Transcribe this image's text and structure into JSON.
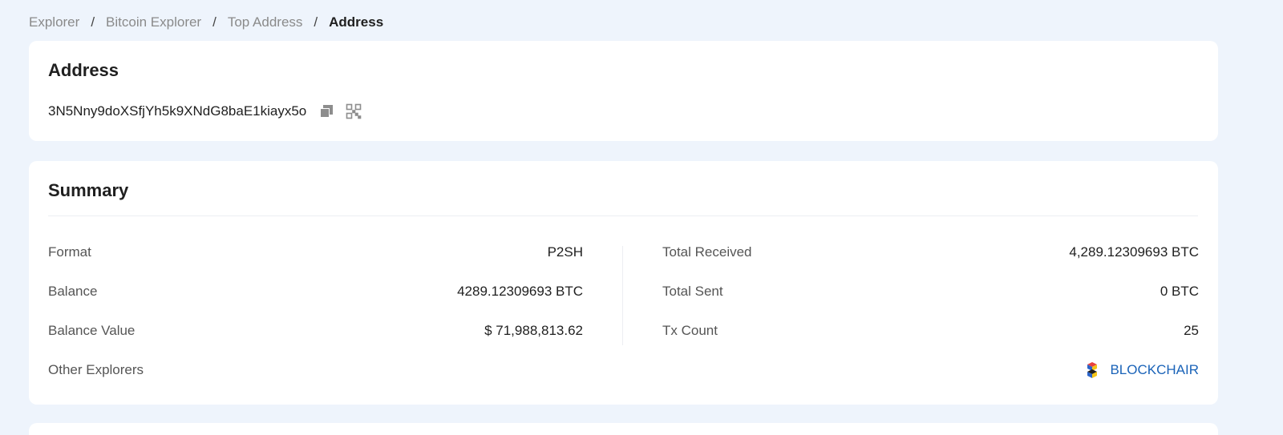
{
  "breadcrumb": {
    "items": [
      "Explorer",
      "Bitcoin Explorer",
      "Top Address"
    ],
    "current": "Address",
    "separator": "/"
  },
  "address_card": {
    "title": "Address",
    "address": "3N5Nny9doXSfjYh5k9XNdG8baE1kiayx5o",
    "icons": [
      "copy-icon",
      "qr-code-icon"
    ]
  },
  "summary": {
    "title": "Summary",
    "left": [
      {
        "label": "Format",
        "value": "P2SH"
      },
      {
        "label": "Balance",
        "value": "4289.12309693 BTC"
      },
      {
        "label": "Balance Value",
        "value": "$ 71,988,813.62"
      }
    ],
    "right": [
      {
        "label": "Total Received",
        "value": "4,289.12309693 BTC"
      },
      {
        "label": "Total Sent",
        "value": "0 BTC"
      },
      {
        "label": "Tx Count",
        "value": "25"
      }
    ],
    "other_explorers": {
      "label": "Other Explorers",
      "link_text": "BLOCKCHAIR",
      "link_icon": "blockchair-logo-icon"
    }
  },
  "colors": {
    "background": "#eef4fc",
    "card": "#ffffff",
    "link": "#1a63b8",
    "muted": "#8a8a8a"
  }
}
